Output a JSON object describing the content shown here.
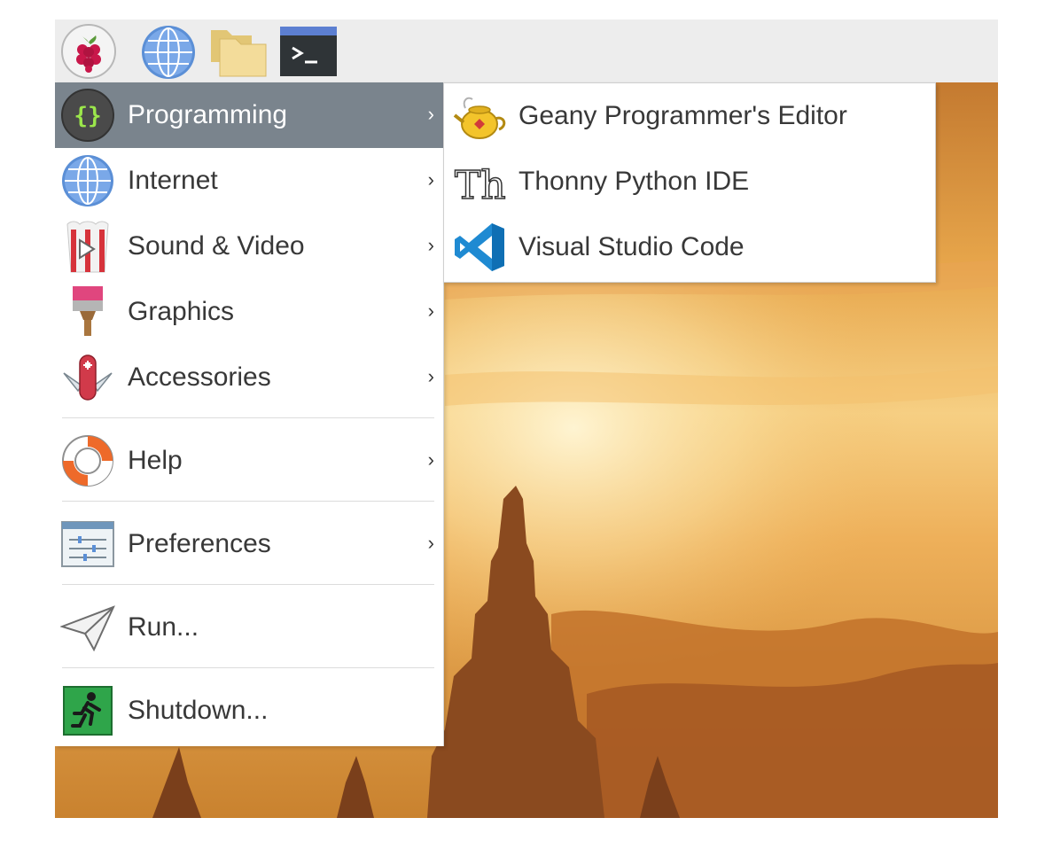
{
  "taskbar": {
    "icons": [
      "raspberry-menu-icon",
      "web-browser-icon",
      "file-manager-icon",
      "terminal-icon"
    ]
  },
  "menu": {
    "items": [
      {
        "label": "Programming",
        "icon": "programming-icon",
        "arrow": "›"
      },
      {
        "label": "Internet",
        "icon": "internet-icon",
        "arrow": "›"
      },
      {
        "label": "Sound & Video",
        "icon": "sound-video-icon",
        "arrow": "›"
      },
      {
        "label": "Graphics",
        "icon": "graphics-icon",
        "arrow": "›"
      },
      {
        "label": "Accessories",
        "icon": "accessories-icon",
        "arrow": "›"
      },
      {
        "label": "Help",
        "icon": "help-icon",
        "arrow": "›"
      },
      {
        "label": "Preferences",
        "icon": "preferences-icon",
        "arrow": "›"
      },
      {
        "label": "Run...",
        "icon": "run-icon"
      },
      {
        "label": "Shutdown...",
        "icon": "shutdown-icon"
      }
    ]
  },
  "submenu": {
    "items": [
      {
        "label": "Geany Programmer's Editor",
        "icon": "geany-icon"
      },
      {
        "label": "Thonny Python IDE",
        "icon": "thonny-icon"
      },
      {
        "label": "Visual Studio Code",
        "icon": "vscode-icon"
      }
    ]
  },
  "colors": {
    "highlight": "#7a848d",
    "taskbar": "#ededed",
    "text": "#383838"
  }
}
